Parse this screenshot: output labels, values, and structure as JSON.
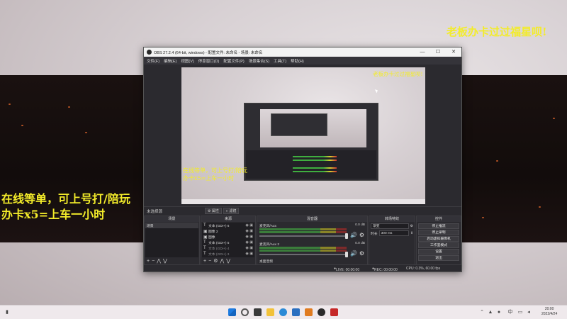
{
  "overlays": {
    "top_right": "老板办卡过过福星呗!",
    "left_line1": "在线等单，可上号打/陪玩",
    "left_line2": "办卡x5=上车一小时"
  },
  "window": {
    "title": "OBS 27.2.4 (64-bit, windows) - 配置文件: 未命名 - 场景: 未命名",
    "minimize": "—",
    "maximize": "☐",
    "close": "✕"
  },
  "menu": [
    "文件(F)",
    "编辑(E)",
    "视图(V)",
    "停靠窗口(D)",
    "配置文件(P)",
    "场景集合(S)",
    "工具(T)",
    "帮助(H)"
  ],
  "preview": {
    "overlay_top": "老板办卡过过福星呗!",
    "overlay_left1": "在线等单，可上号打/陪玩",
    "overlay_left2": "办卡x5=上车一小时"
  },
  "scene_bar": {
    "label": "未选择源",
    "properties": "属性",
    "filters": "滤镜"
  },
  "docks": {
    "scenes": {
      "title": "场景",
      "items": [
        "场景"
      ]
    },
    "sources": {
      "title": "来源",
      "items": [
        {
          "icon": "T",
          "label": "文本 (GDI+) 6",
          "dim": false
        },
        {
          "icon": "▣",
          "label": "图像 2",
          "dim": false
        },
        {
          "icon": "▣",
          "label": "图像",
          "dim": false
        },
        {
          "icon": "T",
          "label": "文本 (GDI+) 5",
          "dim": false
        },
        {
          "icon": "T",
          "label": "文本 (GDI+) 4",
          "dim": true
        },
        {
          "icon": "T",
          "label": "文本 (GDI+) 3",
          "dim": true
        }
      ]
    },
    "mixer": {
      "title": "混音器",
      "channels": [
        {
          "name": "麦克风/Aux",
          "db": "0.0 dB"
        },
        {
          "name": "麦克风/Aux 2",
          "db": "0.0 dB"
        }
      ],
      "footer": "桌面音频"
    },
    "transitions": {
      "title": "转场特效",
      "type": "渐变",
      "duration_label": "时长",
      "duration_value": "300 ms"
    },
    "controls": {
      "title": "控件",
      "buttons": [
        "停止推流",
        "停止录制",
        "启动虚拟摄像机",
        "工作室模式",
        "设置",
        "退出"
      ]
    }
  },
  "status": {
    "live": "LIVE: 00:00:00",
    "rec": "REC: 00:00:00",
    "cpu": "CPU: 0.3%, 60.00 fps"
  },
  "taskbar": {
    "time": "20:00",
    "date": "2022/4/24"
  }
}
